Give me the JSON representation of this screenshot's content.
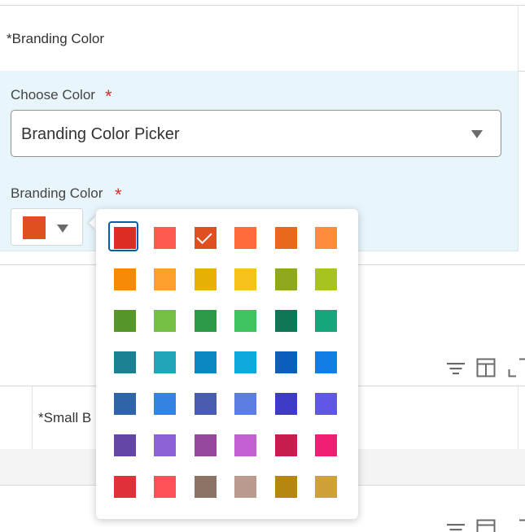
{
  "header": {
    "column_title": "*Branding Color"
  },
  "form": {
    "choose_color_label": "Choose Color",
    "choose_color_required": "*",
    "choose_color_value": "Branding Color Picker",
    "branding_color_label": "Branding Color",
    "branding_color_required": "*",
    "selected_color": "#e04f1f"
  },
  "lower": {
    "row_label": "*Small B",
    "tools": [
      "filter-icon",
      "column-layout-icon",
      "expand-icon"
    ]
  },
  "palette": {
    "colors": [
      "#dd2c24",
      "#ff5a4f",
      "#e04f1f",
      "#ff6b3a",
      "#e8691a",
      "#ff8c3d",
      "#f48a06",
      "#ffa02e",
      "#e8b106",
      "#f7c21c",
      "#8ea91e",
      "#a6c31f",
      "#56962b",
      "#73c043",
      "#2c9a48",
      "#3fc35f",
      "#0e7757",
      "#15a67c",
      "#1b8091",
      "#21a6b7",
      "#0888bf",
      "#0fa9dd",
      "#0a5fbb",
      "#127de5",
      "#2f64a8",
      "#3584e4",
      "#485cb0",
      "#5c7ee4",
      "#3f3bc6",
      "#6057e6",
      "#6446a6",
      "#8c62d6",
      "#94479d",
      "#c45fd4",
      "#c71d4f",
      "#f01f73",
      "#e0303a",
      "#ff5157",
      "#8d7266",
      "#bb9b90",
      "#b68710",
      "#cfa139"
    ],
    "focused_index": 0,
    "checked_index": 2
  }
}
